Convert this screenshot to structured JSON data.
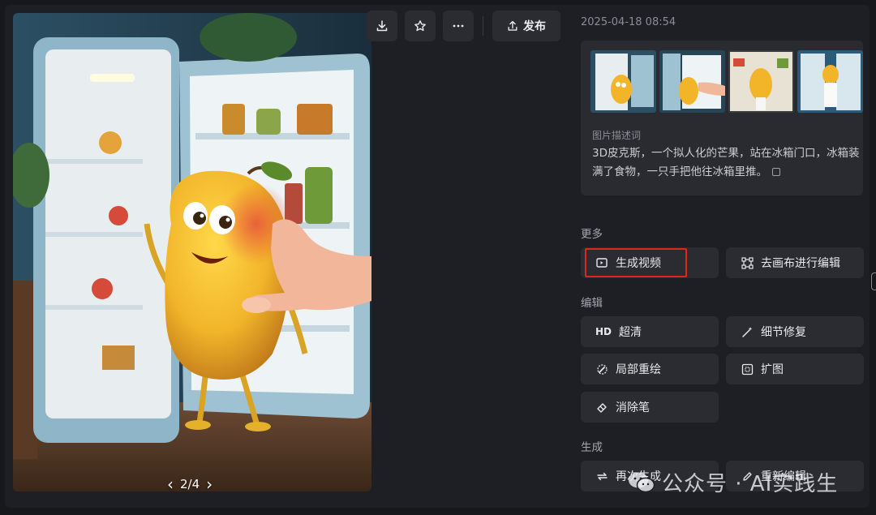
{
  "image_viewer": {
    "image_description_icon": "mango-fridge-image",
    "pager": {
      "current": "2",
      "total": "4",
      "text": "2/4"
    }
  },
  "toolbar": {
    "download_icon": "download-icon",
    "favorite_icon": "star-icon",
    "more_icon": "more-icon",
    "publish_label": "发布"
  },
  "sidebar": {
    "timestamp": "2025-04-18 08:54",
    "prompt_label": "图片描述词",
    "prompt_text": "3D皮克斯，一个拟人化的芒果，站在冰箱门口，冰箱装满了食物，一只手把他往冰箱里推。",
    "sections": {
      "more": "更多",
      "edit": "编辑",
      "generate": "生成"
    },
    "buttons": {
      "generate_video": "生成视频",
      "canvas_edit": "去画布进行编辑",
      "hd": "超清",
      "hd_prefix": "HD",
      "detail_fix": "细节修复",
      "partial_repaint": "局部重绘",
      "expand": "扩图",
      "eraser": "消除笔",
      "regenerate": "再次生成",
      "re_edit": "重新编辑"
    }
  },
  "watermark": {
    "text": "公众号 · AI实践生"
  },
  "colors": {
    "background": "#17181c",
    "panel": "#1e1f24",
    "button": "#2b2c31",
    "highlight": "#e0251f"
  }
}
